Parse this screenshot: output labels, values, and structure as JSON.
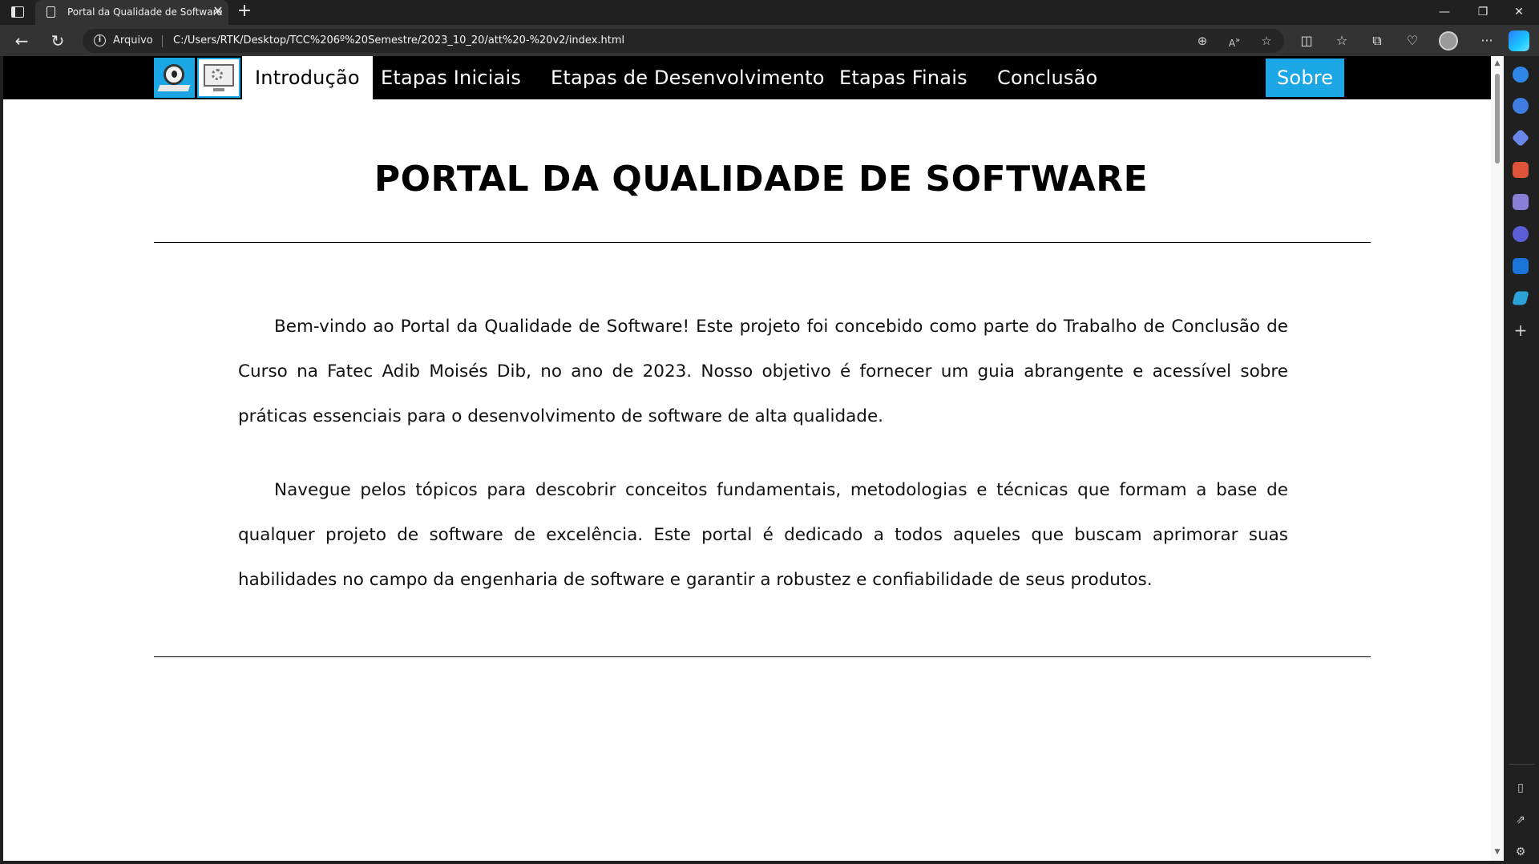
{
  "browser": {
    "tab_title": "Portal da Qualidade de Software",
    "address_scheme": "Arquivo",
    "url": "C:/Users/RTK/Desktop/TCC%206º%20Semestre/2023_10_20/att%20-%20v2/index.html"
  },
  "site": {
    "nav": {
      "items": [
        "Introdução",
        "Etapas Iniciais",
        "Etapas de Desenvolvimento",
        "Etapas Finais",
        "Conclusão"
      ],
      "active": "Introdução",
      "about_label": "Sobre"
    },
    "title": "PORTAL DA QUALIDADE DE SOFTWARE",
    "paragraphs": [
      "Bem-vindo ao Portal da Qualidade de Software! Este projeto foi concebido como parte do Trabalho de Conclusão de Curso na Fatec Adib Moisés Dib, no ano de 2023. Nosso objetivo é fornecer um guia abrangente e acessível sobre práticas essenciais para o desenvolvimento de software de alta qualidade.",
      "Navegue pelos tópicos para descobrir conceitos fundamentais, metodologias e técnicas que formam a base de qualquer projeto de software de excelência. Este portal é dedicado a todos aqueles que buscam aprimorar suas habilidades no campo da engenharia de software e garantir a robustez e confiabilidade de seus produtos."
    ]
  },
  "colors": {
    "accent": "#1ba7e6",
    "nav_background": "#000000",
    "chrome_dark": "#202020"
  }
}
